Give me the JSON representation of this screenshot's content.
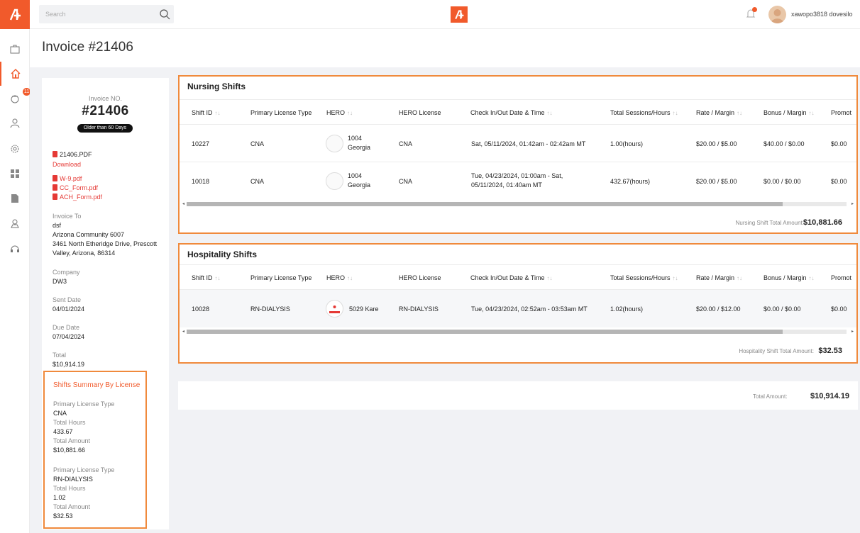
{
  "header": {
    "search_placeholder": "Search",
    "username": "xawopo3818 dovesilo"
  },
  "rail": {
    "badge_count": "11",
    "items": [
      "briefcase-icon",
      "home-icon",
      "nurse-icon",
      "user-icon",
      "settings-icon",
      "grid-icon",
      "documents-icon",
      "map-icon",
      "support-icon"
    ]
  },
  "page": {
    "title": "Invoice #21406"
  },
  "invoice": {
    "no_label": "Invoice NO.",
    "no": "#21406",
    "age_badge": "Older than 60 Days",
    "file_name": "21406.PDF",
    "download": "Download",
    "attachments": [
      "W-9.pdf",
      "CC_Form.pdf",
      "ACH_Form.pdf"
    ],
    "invoice_to_label": "Invoice To",
    "invoice_to_name": "dsf",
    "invoice_to_org": "Arizona Community 6007",
    "invoice_to_addr1": "3461 North Etheridge Drive, Prescott",
    "invoice_to_addr2": "Valley, Arizona, 86314",
    "company_label": "Company",
    "company": "DW3",
    "sent_label": "Sent Date",
    "sent": "04/01/2024",
    "due_label": "Due Date",
    "due": "07/04/2024",
    "total_label": "Total",
    "total": "$10,914.19"
  },
  "summary": {
    "title": "Shifts Summary By License",
    "license_label": "Primary License Type",
    "hours_label": "Total Hours",
    "amount_label": "Total Amount",
    "entries": [
      {
        "license": "CNA",
        "hours": "433.67",
        "amount": "$10,881.66"
      },
      {
        "license": "RN-DIALYSIS",
        "hours": "1.02",
        "amount": "$32.53"
      }
    ]
  },
  "columns": [
    "Shift ID",
    "Primary License Type",
    "HERO",
    "HERO License",
    "Check In/Out Date & Time",
    "Total Sessions/Hours",
    "Rate / Margin",
    "Bonus / Margin",
    "Promot"
  ],
  "nursing": {
    "title": "Nursing Shifts",
    "rows": [
      {
        "id": "10227",
        "license": "CNA",
        "hero_1": "1004",
        "hero_2": "Georgia",
        "hero_license": "CNA",
        "checkin_1": "Sat, 05/11/2024, 01:42am - 02:42am MT",
        "checkin_2": "",
        "hours": "1.00(hours)",
        "rate": "$20.00 / $5.00",
        "bonus": "$40.00 / $0.00",
        "promo": "$0.00"
      },
      {
        "id": "10018",
        "license": "CNA",
        "hero_1": "1004",
        "hero_2": "Georgia",
        "hero_license": "CNA",
        "checkin_1": "Tue, 04/23/2024, 01:00am - Sat,",
        "checkin_2": "05/11/2024, 01:40am MT",
        "hours": "432.67(hours)",
        "rate": "$20.00 / $5.00",
        "bonus": "$0.00 / $0.00",
        "promo": "$0.00"
      }
    ],
    "total_label": "Nursing Shift Total Amount:",
    "total": "$10,881.66"
  },
  "hospitality": {
    "title": "Hospitality Shifts",
    "rows": [
      {
        "id": "10028",
        "license": "RN-DIALYSIS",
        "hero_1": "5029 Kare",
        "hero_license": "RN-DIALYSIS",
        "checkin_1": "Tue, 04/23/2024, 02:52am - 03:53am MT",
        "hours": "1.02(hours)",
        "rate": "$20.00 / $12.00",
        "bonus": "$0.00 / $0.00",
        "promo": "$0.00"
      }
    ],
    "total_label": "Hospitality Shift Total Amount:",
    "total": "$32.53"
  },
  "grand": {
    "label": "Total Amount:",
    "value": "$10,914.19"
  },
  "colors": {
    "accent": "#f15a2b",
    "highlight_border": "#f08a3c",
    "link": "#e53935"
  }
}
